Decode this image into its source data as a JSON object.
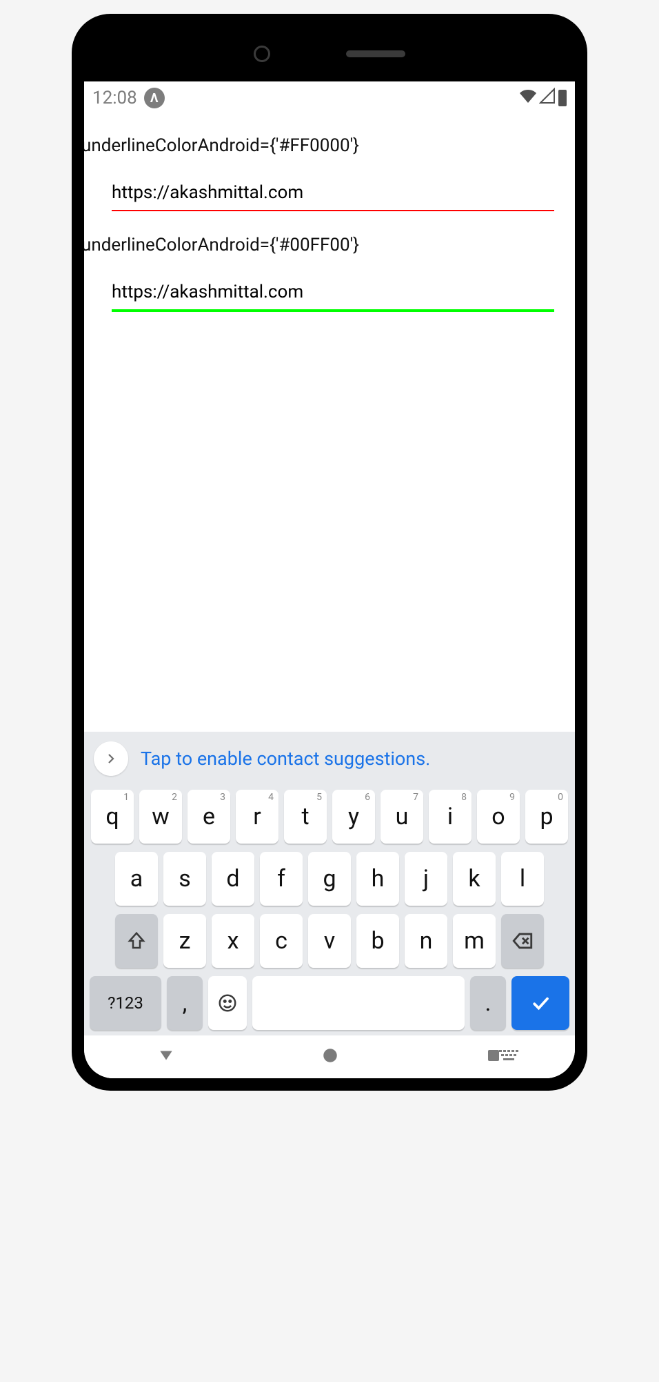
{
  "status": {
    "time": "12:08",
    "app_icon_glyph": "Λ"
  },
  "content": {
    "label1": "underlineColorAndroid={'#FF0000'}",
    "input1_value": "https://akashmittal.com",
    "label2": "underlineColorAndroid={'#00FF00'}",
    "input2_value": "https://akashmittal.com"
  },
  "keyboard": {
    "suggestion_text": "Tap to enable contact suggestions.",
    "row1": [
      {
        "k": "q",
        "s": "1"
      },
      {
        "k": "w",
        "s": "2"
      },
      {
        "k": "e",
        "s": "3"
      },
      {
        "k": "r",
        "s": "4"
      },
      {
        "k": "t",
        "s": "5"
      },
      {
        "k": "y",
        "s": "6"
      },
      {
        "k": "u",
        "s": "7"
      },
      {
        "k": "i",
        "s": "8"
      },
      {
        "k": "o",
        "s": "9"
      },
      {
        "k": "p",
        "s": "0"
      }
    ],
    "row2": [
      "a",
      "s",
      "d",
      "f",
      "g",
      "h",
      "j",
      "k",
      "l"
    ],
    "row3": [
      "z",
      "x",
      "c",
      "v",
      "b",
      "n",
      "m"
    ],
    "symbols_key": "?123",
    "comma_key": ",",
    "period_key": "."
  }
}
